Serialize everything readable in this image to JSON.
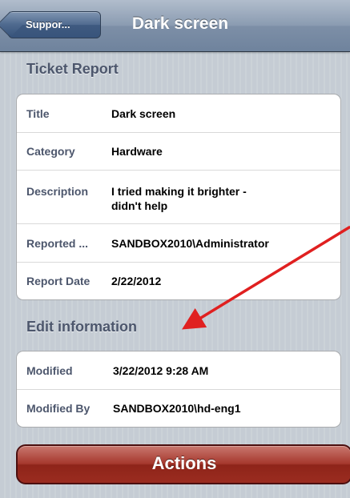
{
  "navbar": {
    "back_label": "Suppor...",
    "title": "Dark screen"
  },
  "ticket_report": {
    "header": "Ticket Report",
    "rows": [
      {
        "label": "Title",
        "value": "Dark screen"
      },
      {
        "label": "Category",
        "value": "Hardware"
      },
      {
        "label": "Description",
        "value_line1": "I tried making it brighter -",
        "value_line2": "didn't help"
      },
      {
        "label": "Reported ...",
        "value": "SANDBOX2010\\Administrator"
      },
      {
        "label": "Report Date",
        "value": "2/22/2012"
      }
    ]
  },
  "edit_information": {
    "header": "Edit information",
    "rows": [
      {
        "label": "Modified",
        "value": "3/22/2012 9:28 AM"
      },
      {
        "label": "Modified By",
        "value": "SANDBOX2010\\hd-eng1"
      }
    ]
  },
  "actions_button": {
    "label": "Actions"
  },
  "colors": {
    "annotation_arrow": "#e02020",
    "actions_button": "#9b2c20",
    "navbar": "#7d8fa7"
  }
}
